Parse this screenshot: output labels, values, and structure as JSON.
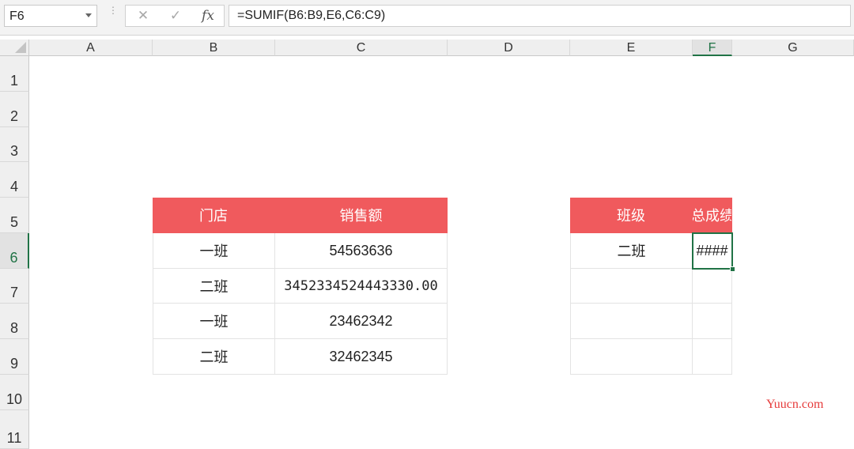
{
  "formula_bar": {
    "name_box": "F6",
    "cancel_icon": "✕",
    "enter_icon": "✓",
    "fx_label": "fx",
    "formula": "=SUMIF(B6:B9,E6,C6:C9)"
  },
  "columns": [
    "A",
    "B",
    "C",
    "D",
    "E",
    "F",
    "G"
  ],
  "selected_column": "F",
  "rows": [
    "1",
    "2",
    "3",
    "4",
    "5",
    "6",
    "7",
    "8",
    "9",
    "10",
    "11"
  ],
  "selected_row": "6",
  "table1": {
    "headers": [
      "门店",
      "销售额"
    ],
    "rows": [
      [
        "一班",
        "54563636"
      ],
      [
        "二班",
        "3452334524443330.00"
      ],
      [
        "一班",
        "23462342"
      ],
      [
        "二班",
        "32462345"
      ]
    ]
  },
  "table2": {
    "headers": [
      "班级",
      "总成绩"
    ],
    "rows": [
      [
        "二班",
        "####"
      ],
      [
        "",
        ""
      ],
      [
        "",
        ""
      ],
      [
        "",
        ""
      ]
    ]
  },
  "watermark": "Yuucn.com",
  "colors": {
    "header_fill": "#f05a5d",
    "selection": "#217346"
  }
}
